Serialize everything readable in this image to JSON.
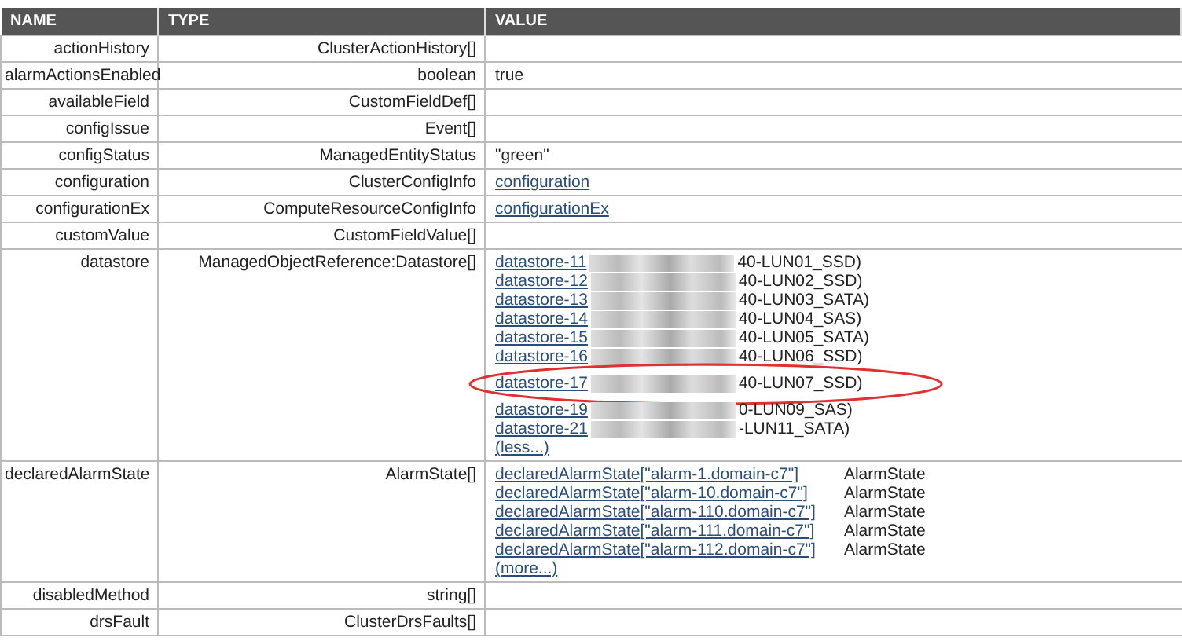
{
  "table": {
    "columns": [
      "NAME",
      "TYPE",
      "VALUE"
    ],
    "rows": [
      {
        "name": "actionHistory",
        "type": "ClusterActionHistory[]",
        "kind": "empty"
      },
      {
        "name": "alarmActionsEnabled",
        "type": "boolean",
        "kind": "text",
        "value": "true"
      },
      {
        "name": "availableField",
        "type": "CustomFieldDef[]",
        "kind": "empty"
      },
      {
        "name": "configIssue",
        "type": "Event[]",
        "kind": "empty"
      },
      {
        "name": "configStatus",
        "type": "ManagedEntityStatus",
        "kind": "text",
        "value": "\"green\""
      },
      {
        "name": "configuration",
        "type": "ClusterConfigInfo",
        "kind": "link",
        "value": "configuration"
      },
      {
        "name": "configurationEx",
        "type": "ComputeResourceConfigInfo",
        "kind": "link",
        "value": "configurationEx"
      },
      {
        "name": "customValue",
        "type": "CustomFieldValue[]",
        "kind": "empty"
      },
      {
        "name": "datastore",
        "type": "ManagedObjectReference:Datastore[]",
        "kind": "datastores",
        "toggle": "(less...)",
        "items": [
          {
            "link": "datastore-11",
            "suffix": "40-LUN01_SSD)",
            "circled": false
          },
          {
            "link": "datastore-12",
            "suffix": "40-LUN02_SSD)",
            "circled": false
          },
          {
            "link": "datastore-13",
            "suffix": "40-LUN03_SATA)",
            "circled": false
          },
          {
            "link": "datastore-14",
            "suffix": "40-LUN04_SAS)",
            "circled": false
          },
          {
            "link": "datastore-15",
            "suffix": "40-LUN05_SATA)",
            "circled": false
          },
          {
            "link": "datastore-16",
            "suffix": "40-LUN06_SSD)",
            "circled": false
          },
          {
            "link": "datastore-17",
            "suffix": "40-LUN07_SSD)",
            "circled": true
          },
          {
            "link": "datastore-19",
            "suffix": "0-LUN09_SAS)",
            "circled": false
          },
          {
            "link": "datastore-21",
            "suffix": "-LUN11_SATA)",
            "circled": false
          }
        ]
      },
      {
        "name": "declaredAlarmState",
        "type": "AlarmState[]",
        "kind": "alarms",
        "toggle": "(more...)",
        "items": [
          {
            "link": "declaredAlarmState",
            "key": "[\"alarm-1.domain-c7\"]",
            "type": "AlarmState"
          },
          {
            "link": "declaredAlarmState",
            "key": "[\"alarm-10.domain-c7\"]",
            "type": "AlarmState"
          },
          {
            "link": "declaredAlarmState",
            "key": "[\"alarm-110.domain-c7\"]",
            "type": "AlarmState"
          },
          {
            "link": "declaredAlarmState",
            "key": "[\"alarm-111.domain-c7\"]",
            "type": "AlarmState"
          },
          {
            "link": "declaredAlarmState",
            "key": "[\"alarm-112.domain-c7\"]",
            "type": "AlarmState"
          }
        ]
      },
      {
        "name": "disabledMethod",
        "type": "string[]",
        "kind": "empty"
      },
      {
        "name": "drsFault",
        "type": "ClusterDrsFaults[]",
        "kind": "empty"
      }
    ]
  }
}
